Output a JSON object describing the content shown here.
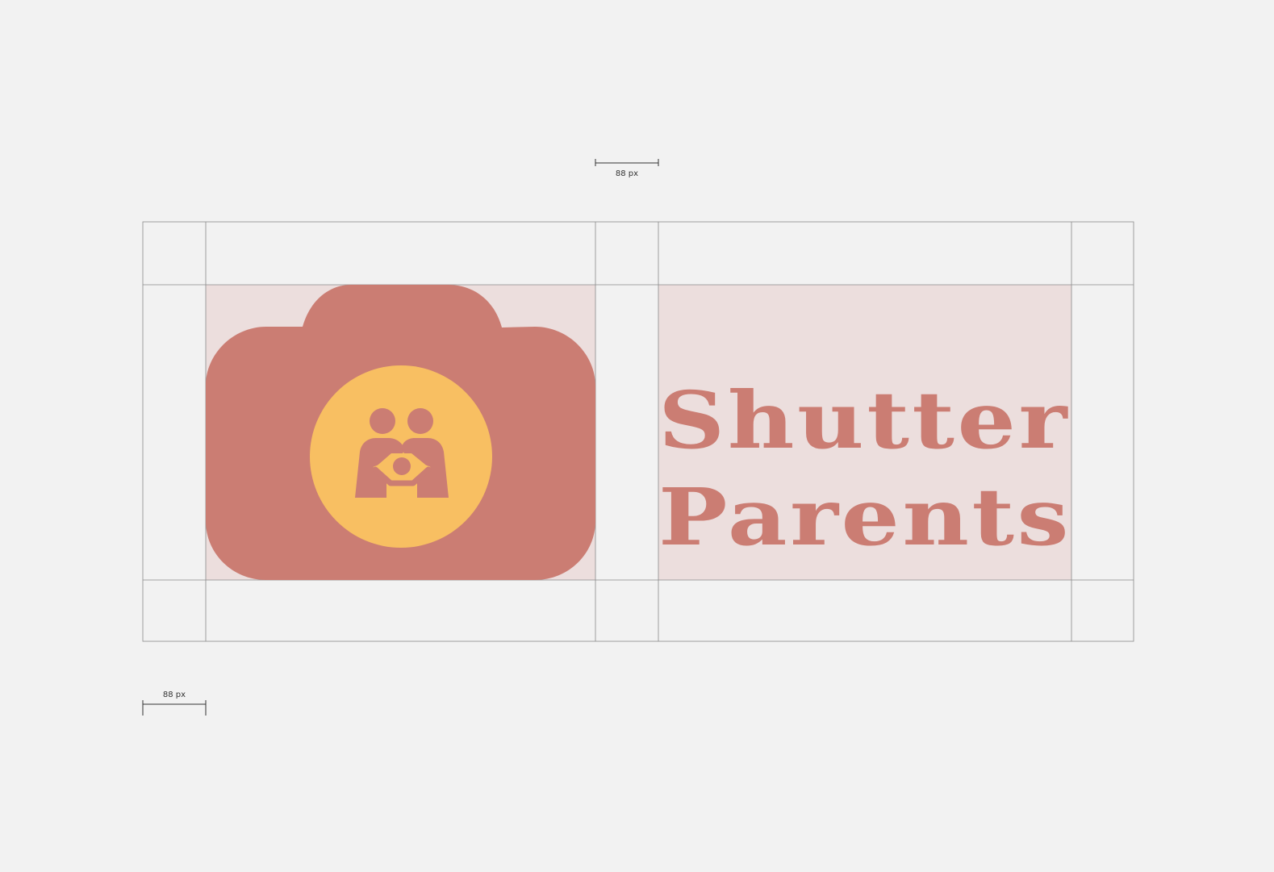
{
  "colors": {
    "background": "#f2f2f2",
    "grid_line": "#8a8a8a",
    "safe_zone_fill": "#ecdedd",
    "brand_primary": "#cb7d73",
    "brand_accent": "#f8bf62",
    "measure_text": "#333333"
  },
  "measurements": {
    "top_label": "88 px",
    "bottom_label": "88 px"
  },
  "logo": {
    "mark_name": "camera-family-icon",
    "wordmark_line1": "Shutter",
    "wordmark_line2": "Parents"
  }
}
